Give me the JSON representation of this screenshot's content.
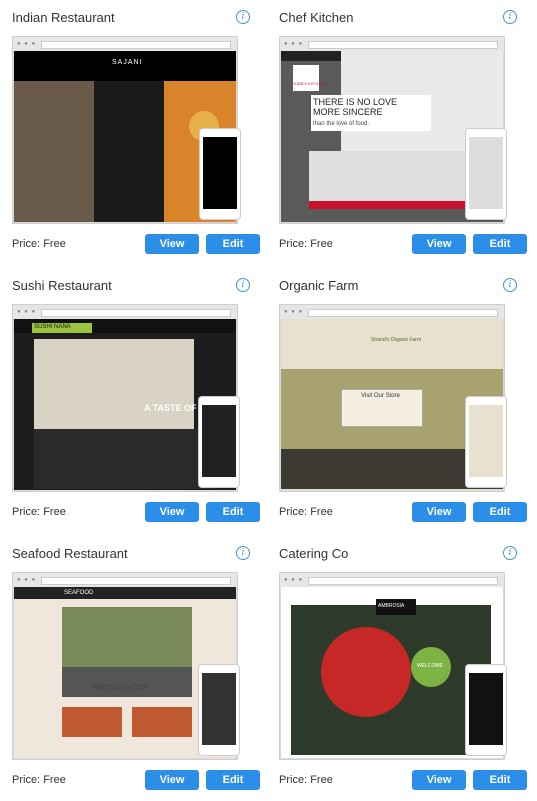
{
  "templates": [
    {
      "title": "Indian Restaurant",
      "price_label": "Price:",
      "price": "Free",
      "view": "View",
      "edit": "Edit",
      "site": "SAJANI",
      "accent": "#e34a2f"
    },
    {
      "title": "Chef Kitchen",
      "price_label": "Price:",
      "price": "Free",
      "view": "View",
      "edit": "Edit",
      "site": "JUDE'S KITCHEN",
      "headline": "THERE IS NO LOVE MORE SINCERE",
      "sub": "than the love of food.",
      "accent": "#c8102e"
    },
    {
      "title": "Sushi Restaurant",
      "price_label": "Price:",
      "price": "Free",
      "view": "View",
      "edit": "Edit",
      "site": "SUSHI NANA",
      "headline": "A TASTE OF JA",
      "accent": "#9bc53d"
    },
    {
      "title": "Organic Farm",
      "price_label": "Price:",
      "price": "Free",
      "view": "View",
      "edit": "Edit",
      "site": "Strand's Organic Farm",
      "headline": "Visit Our Store",
      "accent": "#6b8e23"
    },
    {
      "title": "Seafood Restaurant",
      "price_label": "Price:",
      "price": "Free",
      "view": "View",
      "edit": "Edit",
      "site": "SEAFOOD",
      "headline": "FRESH CATCH",
      "accent": "#9bc53d"
    },
    {
      "title": "Catering Co",
      "price_label": "Price:",
      "price": "Free",
      "view": "View",
      "edit": "Edit",
      "site": "AMBROSIA",
      "headline": "WELCOME",
      "accent": "#7cb342"
    }
  ]
}
